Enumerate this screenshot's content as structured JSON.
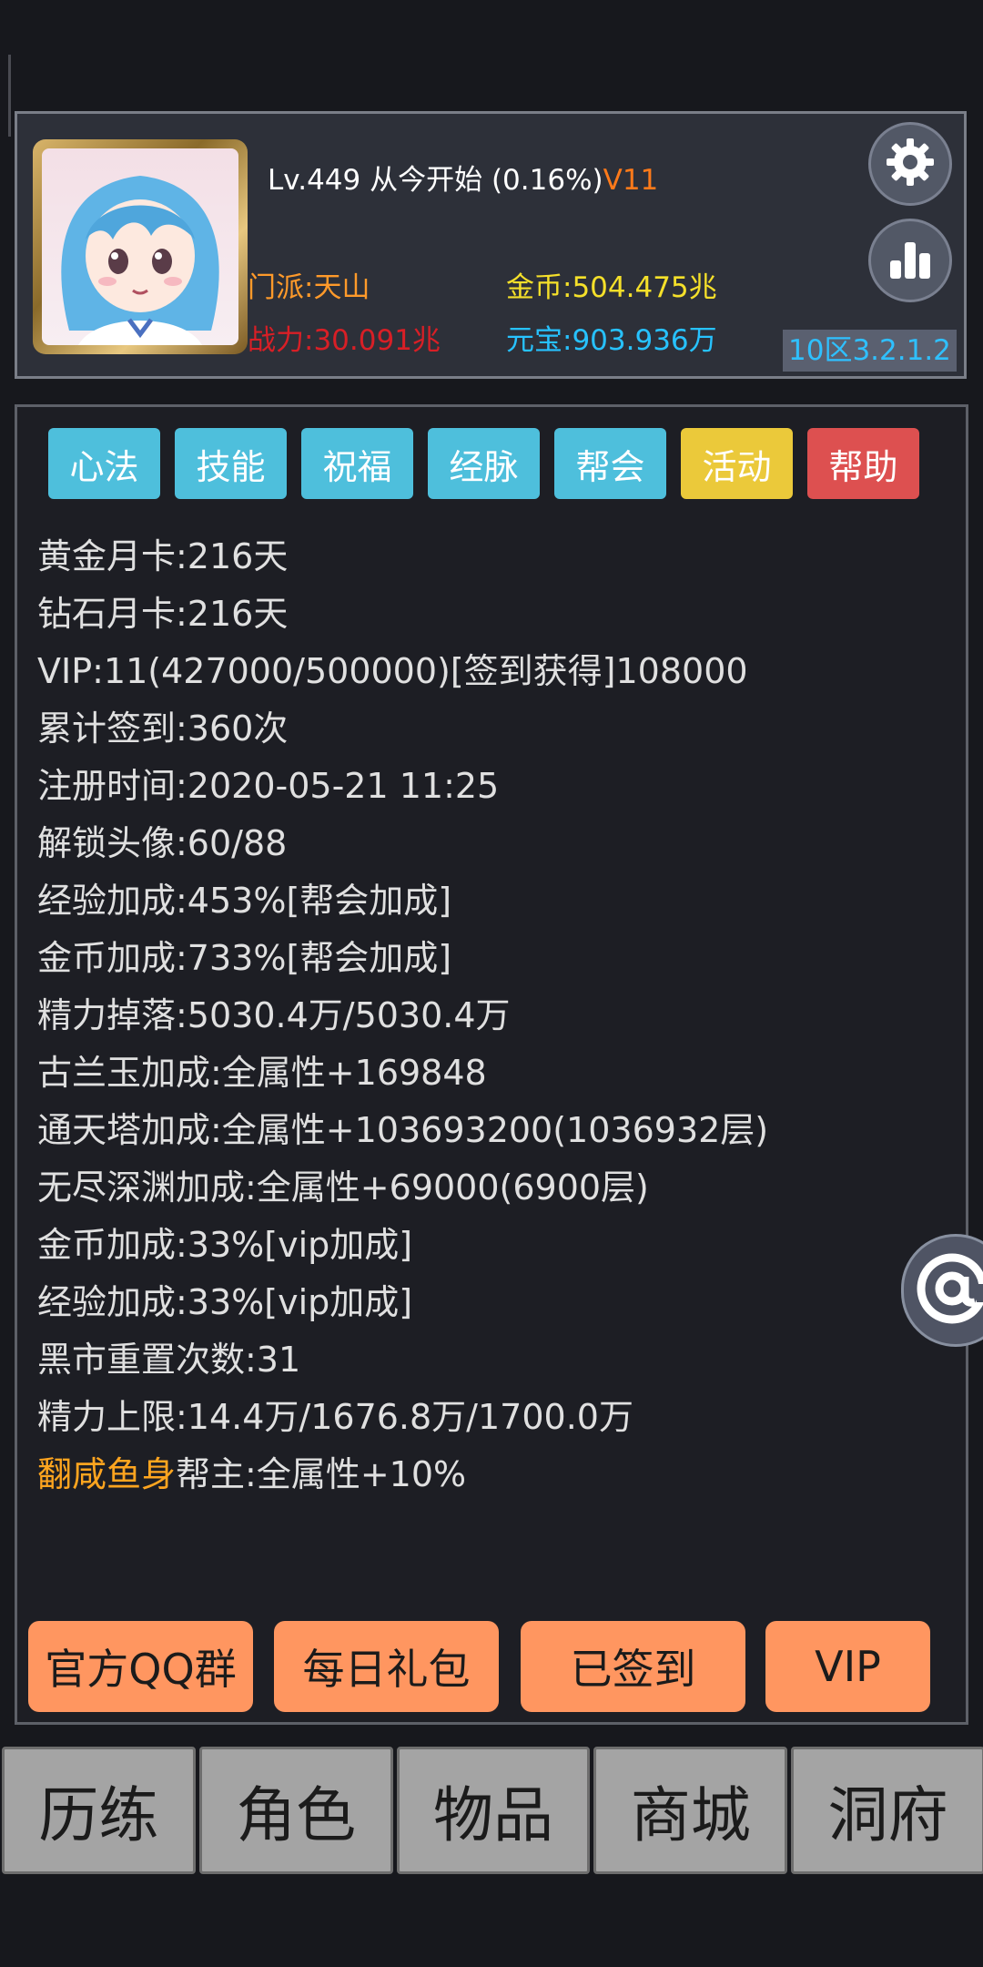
{
  "header": {
    "level": "Lv.449",
    "name": "从今开始",
    "progress": "(0.16%)",
    "vip": "V11",
    "sect": "门派:天山",
    "power": "战力:30.091兆",
    "gold": "金币:504.475兆",
    "ingot": "元宝:903.936万",
    "server": "10区3.2.1.2",
    "icons": {
      "settings": "gear-icon",
      "stats": "bar-chart-icon"
    }
  },
  "tabs": [
    {
      "label": "心法",
      "color": "#4ebfdc"
    },
    {
      "label": "技能",
      "color": "#4ebfdc"
    },
    {
      "label": "祝福",
      "color": "#4ebfdc"
    },
    {
      "label": "经脉",
      "color": "#4ebfdc"
    },
    {
      "label": "帮会",
      "color": "#4ebfdc"
    },
    {
      "label": "活动",
      "color": "#ebc93a"
    },
    {
      "label": "帮助",
      "color": "#dd5050"
    }
  ],
  "info": [
    "黄金月卡:216天",
    "钻石月卡:216天",
    "VIP:11(427000/500000)[签到获得]108000",
    "累计签到:360次",
    "注册时间:2020-05-21 11:25",
    "解锁头像:60/88",
    "经验加成:453%[帮会加成]",
    "金币加成:733%[帮会加成]",
    "精力掉落:5030.4万/5030.4万",
    "古兰玉加成:全属性+169848",
    "通天塔加成:全属性+103693200(1036932层)",
    "无尽深渊加成:全属性+69000(6900层)",
    "金币加成:33%[vip加成]",
    "经验加成:33%[vip加成]",
    "黑市重置次数:31",
    "精力上限:14.4万/1676.8万/1700.0万"
  ],
  "guild_line": {
    "guild_name": "翻咸鱼身",
    "rest": "帮主:全属性+10%"
  },
  "actions": [
    "官方QQ群",
    "每日礼包",
    "已签到",
    "VIP"
  ],
  "float_button": "@",
  "nav": [
    "历练",
    "角色",
    "物品",
    "商城",
    "洞府"
  ]
}
